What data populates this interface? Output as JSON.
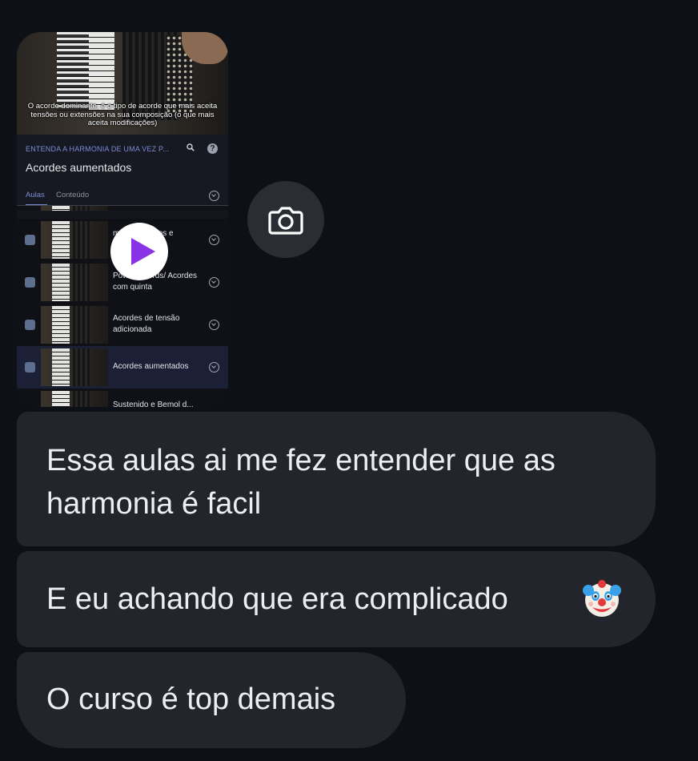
{
  "media": {
    "subtitle": "O acorde dominante, é o tipo de acorde que mais aceita tensões ou extensões na sua composição (o que mais aceita modificações)",
    "course_kicker": "ENTENDA A HARMONIA DE UMA VEZ P...",
    "search_icon": "search-icon",
    "help_icon": "?",
    "course_title": "Acordes aumentados",
    "tabs": [
      "Aulas",
      "Conteúdo"
    ],
    "lessons": [
      {
        "label": "meio diminutos e diminut..."
      },
      {
        "label": "Power Chords/ Acordes com quinta"
      },
      {
        "label": "Acordes de tensão adicionada"
      },
      {
        "label": "Acordes aumentados",
        "active": true
      },
      {
        "label": "Sustenido e Bemol d..."
      }
    ],
    "play_icon": "play-icon"
  },
  "camera_icon": "camera-icon",
  "messages": [
    {
      "text": "Essa aulas ai me fez entender que as harmonia é facil"
    },
    {
      "text": "E eu achando que era complicado",
      "emoji": "clown-face-icon"
    },
    {
      "text": "O curso é top demais"
    }
  ]
}
